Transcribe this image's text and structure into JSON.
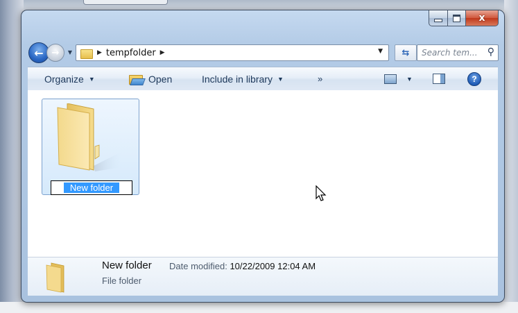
{
  "window": {
    "minimize_glyph": "—",
    "maximize_glyph": "□",
    "close_glyph": "x"
  },
  "nav": {
    "back_glyph": "←",
    "forward_glyph": "→",
    "breadcrumb_current": "tempfolder",
    "search_placeholder": "Search tem..."
  },
  "toolbar": {
    "organize_label": "Organize",
    "open_label": "Open",
    "include_label": "Include in library",
    "more_label": "»",
    "help_glyph": "?"
  },
  "content": {
    "items": [
      {
        "name": "New folder",
        "state": "renaming"
      }
    ]
  },
  "details": {
    "name": "New folder",
    "date_label": "Date modified:",
    "date_value": "10/22/2009 12:04 AM",
    "type": "File folder"
  },
  "colors": {
    "selection_fill": "#3399ff",
    "close_button": "#c7442a",
    "toolbar_text": "#1e395b"
  }
}
